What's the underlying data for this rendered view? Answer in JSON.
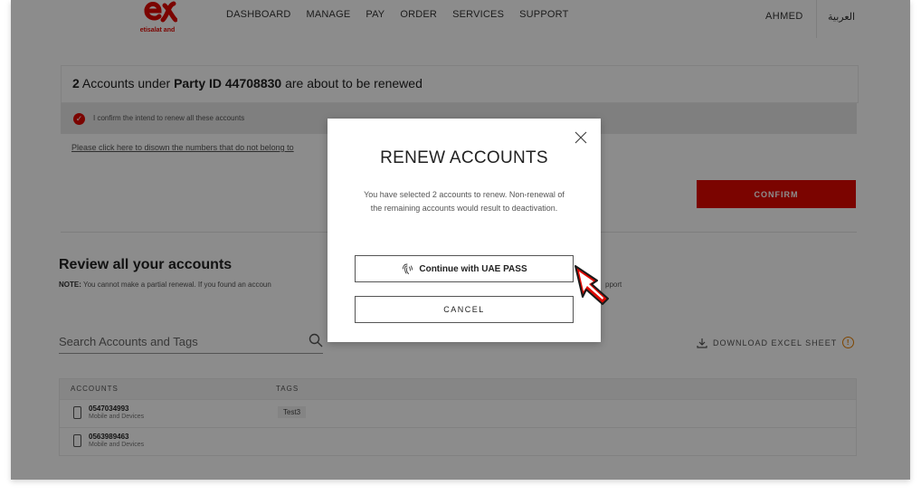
{
  "brand": {
    "logo_text": "etisalat and",
    "brand_color": "#e00800"
  },
  "nav": {
    "items": [
      "DASHBOARD",
      "MANAGE",
      "PAY",
      "ORDER",
      "SERVICES",
      "SUPPORT"
    ],
    "user": "AHMED",
    "language": "العربية"
  },
  "renewal": {
    "count": "2",
    "text_mid": " Accounts under ",
    "party_label": "Party ID 44708830",
    "text_end": " are about to be renewed",
    "confirm_label": "I confirm the intend to renew all these accounts",
    "disown_link": "Please click here to disown the numbers that do not belong to",
    "confirm_button": "CONFIRM"
  },
  "review": {
    "title": "Review all your accounts",
    "note_bold": "NOTE:",
    "note_text": " You cannot make a partial renewal. If you found an accoun",
    "note_tail": "pport",
    "search_placeholder": "Search Accounts and Tags",
    "download_label": "DOWNLOAD EXCEL SHEET",
    "info_icon": "!",
    "columns": [
      "ACCOUNTS",
      "TAGS"
    ],
    "rows": [
      {
        "number": "0547034993",
        "type": "Mobile and Devices",
        "tag": "Test3"
      },
      {
        "number": "0563989463",
        "type": "Mobile and Devices",
        "tag": ""
      }
    ]
  },
  "modal": {
    "title": "RENEW ACCOUNTS",
    "message": "You have selected 2 accounts to renew. Non-renewal of the remaining accounts would result to deactivation.",
    "uae_pass_button": "Continue with UAE PASS",
    "cancel_button": "CANCEL"
  }
}
